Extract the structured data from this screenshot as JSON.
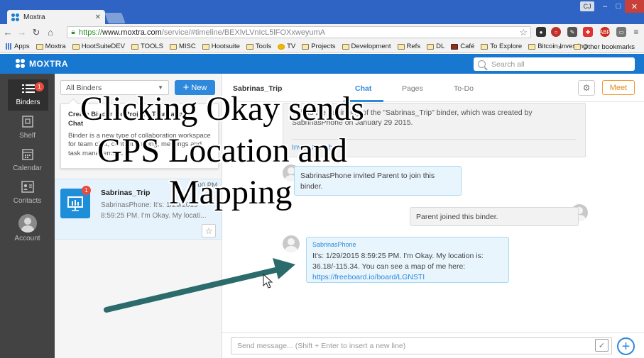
{
  "browser": {
    "tab_title": "Moxtra",
    "tab_close": "✕",
    "profile": "CJ",
    "minimize": "–",
    "maximize": "□",
    "close": "✕",
    "url_scheme": "https://",
    "url_host": "www.moxtra.com",
    "url_path": "/service/#timeline/BEXlvLVnIcL5lFOXxweyumA",
    "bookmarks": [
      "Apps",
      "Moxtra",
      "HootSuiteDEV",
      "TOOLS",
      "MISC",
      "Hootsuite",
      "Tools",
      "TV",
      "Projects",
      "Development",
      "Refs",
      "DL",
      "Café",
      "To Explore",
      "Bitcoin Investing"
    ],
    "bookmarks_more": "»",
    "other_bookmarks": "Other bookmarks"
  },
  "app": {
    "logo": "MOXTRA",
    "search_placeholder": "Search all"
  },
  "leftnav": {
    "binders": "Binders",
    "binders_badge": "1",
    "shelf": "Shelf",
    "calendar": "Calendar",
    "contacts": "Contacts",
    "account": "Account"
  },
  "binderlist": {
    "filter": "All Binders",
    "new_button": "New",
    "tip_title": "Create Binder for Project, Team and Chat",
    "tip_body": "Binder is a new type of collaboration workspace for team chat, content sharing, meetings and task management.",
    "item": {
      "name": "Sabrinas_Trip",
      "time": "8:00 PM",
      "badge": "1",
      "preview": "SabrinasPhone: It's: 1/29/2015 8:59:25 PM. I'm Okay. My locati..."
    }
  },
  "chat": {
    "binder_title": "Sabrinas_Trip",
    "tabs": [
      "Chat",
      "Pages",
      "To-Do"
    ],
    "meet_button": "Meet",
    "system_message": "This is the beginning of the \"Sabrinas_Trip\" binder, which was created by SabrinasPhone on January 29 2015.",
    "invite_link": "Invite Member",
    "messages": [
      {
        "text": "SabrinasPhone invited Parent to join this binder."
      },
      {
        "text": "Parent joined this binder."
      },
      {
        "sender": "SabrinasPhone",
        "text": "It's: 1/29/2015 8:59:25 PM. I'm Okay. My location is: 36.18/-115.34. You can see a map of me here: ",
        "link": "https://freeboard.io/board/LGNSTI"
      }
    ],
    "composer_placeholder": "Send message... (Shift + Enter to insert a new line)"
  },
  "overlay": {
    "caption_lines": [
      "Clicking Okay sends",
      "GPS Location and",
      "Mapping"
    ],
    "arrow_color": "#2b6b6b"
  }
}
